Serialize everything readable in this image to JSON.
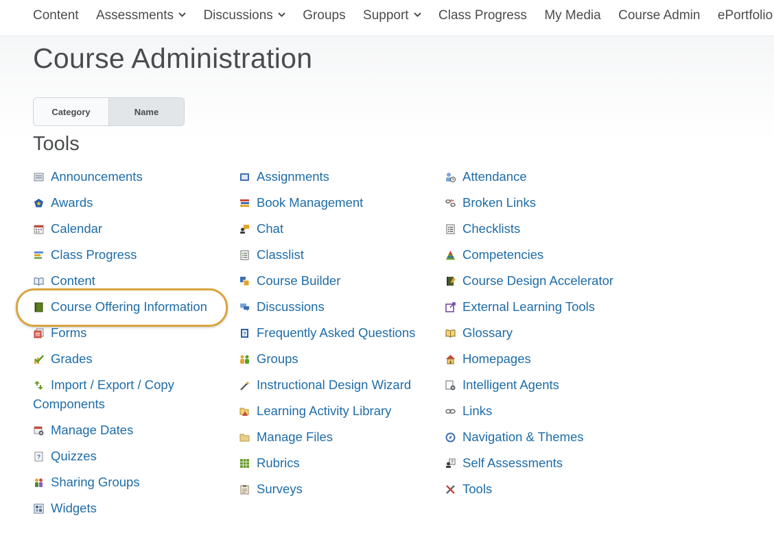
{
  "nav": {
    "items": [
      {
        "label": "Content",
        "dropdown": false
      },
      {
        "label": "Assessments",
        "dropdown": true
      },
      {
        "label": "Discussions",
        "dropdown": true
      },
      {
        "label": "Groups",
        "dropdown": false
      },
      {
        "label": "Support",
        "dropdown": true
      },
      {
        "label": "Class Progress",
        "dropdown": false
      },
      {
        "label": "My Media",
        "dropdown": false
      },
      {
        "label": "Course Admin",
        "dropdown": false
      },
      {
        "label": "ePortfolio",
        "dropdown": false
      }
    ]
  },
  "page": {
    "title": "Course Administration",
    "view_toggle": {
      "category": "Category",
      "name": "Name",
      "selected": "Name"
    },
    "section_title": "Tools"
  },
  "tools": {
    "col1": [
      {
        "label": "Announcements",
        "icon": "announcements-icon"
      },
      {
        "label": "Awards",
        "icon": "awards-icon"
      },
      {
        "label": "Calendar",
        "icon": "calendar-icon"
      },
      {
        "label": "Class Progress",
        "icon": "class-progress-icon"
      },
      {
        "label": "Content",
        "icon": "content-icon"
      },
      {
        "label": "Course Offering Information",
        "icon": "course-offering-icon",
        "highlighted": true
      },
      {
        "label": "Forms",
        "icon": "forms-icon"
      },
      {
        "label": "Grades",
        "icon": "grades-icon"
      },
      {
        "label": "Import / Export / Copy Components",
        "icon": "import-export-icon"
      },
      {
        "label": "Manage Dates",
        "icon": "manage-dates-icon"
      },
      {
        "label": "Quizzes",
        "icon": "quizzes-icon"
      },
      {
        "label": "Sharing Groups",
        "icon": "sharing-groups-icon"
      },
      {
        "label": "Widgets",
        "icon": "widgets-icon"
      }
    ],
    "col2": [
      {
        "label": "Assignments",
        "icon": "assignments-icon"
      },
      {
        "label": "Book Management",
        "icon": "book-management-icon"
      },
      {
        "label": "Chat",
        "icon": "chat-icon"
      },
      {
        "label": "Classlist",
        "icon": "classlist-icon"
      },
      {
        "label": "Course Builder",
        "icon": "course-builder-icon"
      },
      {
        "label": "Discussions",
        "icon": "discussions-icon"
      },
      {
        "label": "Frequently Asked Questions",
        "icon": "faq-icon"
      },
      {
        "label": "Groups",
        "icon": "groups-icon"
      },
      {
        "label": "Instructional Design Wizard",
        "icon": "wizard-icon"
      },
      {
        "label": "Learning Activity Library",
        "icon": "activity-library-icon"
      },
      {
        "label": "Manage Files",
        "icon": "folder-icon"
      },
      {
        "label": "Rubrics",
        "icon": "rubrics-icon"
      },
      {
        "label": "Surveys",
        "icon": "surveys-icon"
      }
    ],
    "col3": [
      {
        "label": "Attendance",
        "icon": "attendance-icon"
      },
      {
        "label": "Broken Links",
        "icon": "broken-links-icon"
      },
      {
        "label": "Checklists",
        "icon": "checklists-icon"
      },
      {
        "label": "Competencies",
        "icon": "competencies-icon"
      },
      {
        "label": "Course Design Accelerator",
        "icon": "design-accelerator-icon"
      },
      {
        "label": "External Learning Tools",
        "icon": "external-tools-icon"
      },
      {
        "label": "Glossary",
        "icon": "glossary-icon"
      },
      {
        "label": "Homepages",
        "icon": "home-icon"
      },
      {
        "label": "Intelligent Agents",
        "icon": "intelligent-agents-icon"
      },
      {
        "label": "Links",
        "icon": "links-icon"
      },
      {
        "label": "Navigation & Themes",
        "icon": "navigation-icon"
      },
      {
        "label": "Self Assessments",
        "icon": "self-assessments-icon"
      },
      {
        "label": "Tools",
        "icon": "tools-icon"
      }
    ]
  },
  "colors": {
    "link": "#1e6ca8",
    "text": "#494c4e",
    "highlight": "#d9a53c"
  }
}
